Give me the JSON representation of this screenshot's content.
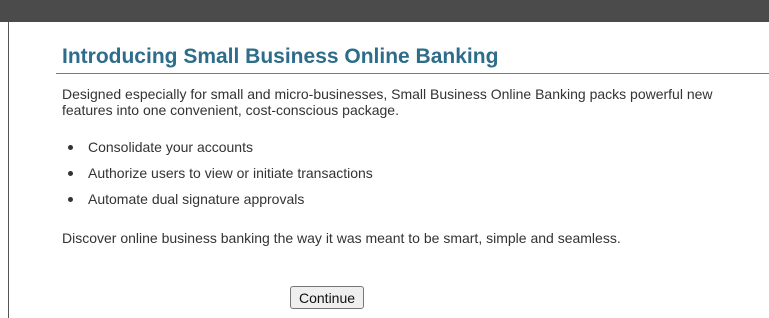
{
  "promo": {
    "title": "Introducing Small Business Online Banking",
    "intro": "Designed especially for small and micro-businesses, Small Business Online Banking packs powerful new features into one convenient, cost-conscious package.",
    "features": [
      "Consolidate your accounts",
      "Authorize users to view or initiate transactions",
      "Automate dual signature approvals"
    ],
    "closing": "Discover online business banking the way it was meant to be smart, simple and seamless.",
    "continue_label": "Continue"
  },
  "colors": {
    "title": "#2d6d8b",
    "top_bar": "#4b4b4b",
    "text": "#333333"
  }
}
